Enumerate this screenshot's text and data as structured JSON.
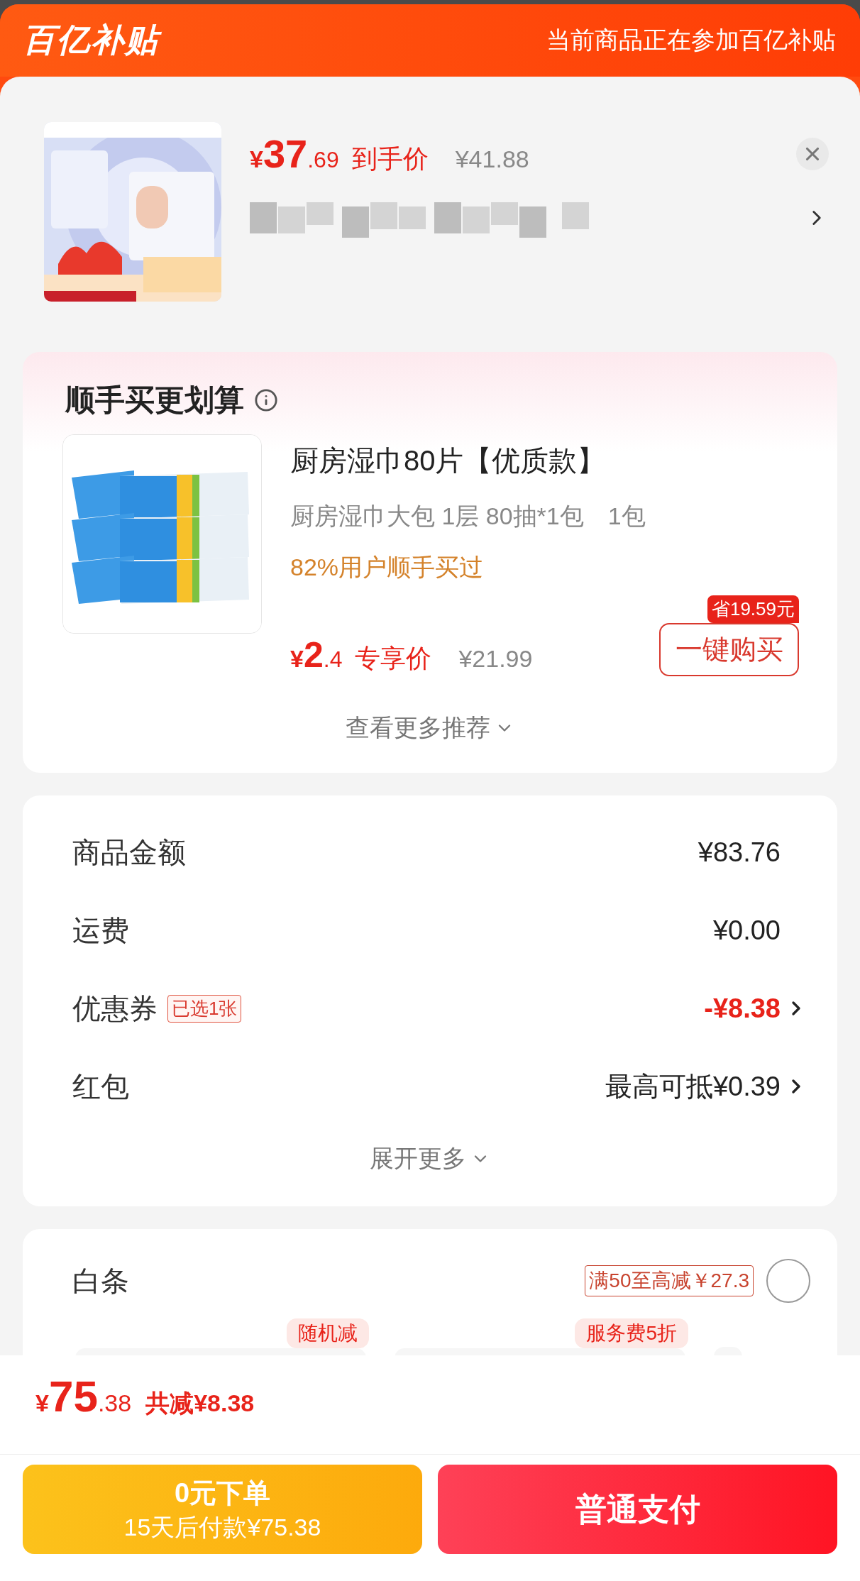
{
  "header": {
    "logo": "百亿补贴",
    "notice": "当前商品正在参加百亿补贴"
  },
  "product": {
    "kind": "picture",
    "price_symbol": "¥",
    "price_int": "37",
    "price_dec": ".69",
    "price_label": "到手价",
    "original_price": "¥41.88"
  },
  "recommend": {
    "title": "顺手买更划算",
    "item": {
      "kind": "picture",
      "name": "厨房湿巾80片【优质款】",
      "spec": "厨房湿巾大包 1层 80抽*1包",
      "quantity": "1包",
      "social": "82%用户顺手买过",
      "price_symbol": "¥",
      "price_int": "2",
      "price_dec": ".4",
      "price_label": "专享价",
      "original_price": "¥21.99",
      "badge": "省19.59元",
      "button": "一键购买"
    },
    "more": "查看更多推荐"
  },
  "summary": {
    "rows": [
      {
        "kind": "plain",
        "label": "商品金额",
        "value": "¥83.76",
        "arrow": false
      },
      {
        "kind": "plain",
        "label": "运费",
        "value": "¥0.00",
        "arrow": false
      },
      {
        "kind": "discount",
        "label": "优惠券",
        "tag": "已选1张",
        "value": "-¥8.38",
        "arrow": true
      },
      {
        "kind": "plain",
        "label": "红包",
        "value": "最高可抵¥0.39",
        "arrow": true
      }
    ],
    "expand": "展开更多"
  },
  "payment": {
    "label": "白条",
    "promo": "满50至高减￥27.3",
    "selected": false,
    "options": [
      {
        "tag": "随机减"
      },
      {
        "tag": "服务费5折"
      }
    ]
  },
  "total": {
    "symbol": "¥",
    "int": "75",
    "dec": ".38",
    "saved": "共减¥8.38"
  },
  "buttons": [
    {
      "kind": "credit",
      "title": "0元下单",
      "subtitle": "15天后付款¥75.38"
    },
    {
      "kind": "normal",
      "title": "普通支付"
    }
  ]
}
